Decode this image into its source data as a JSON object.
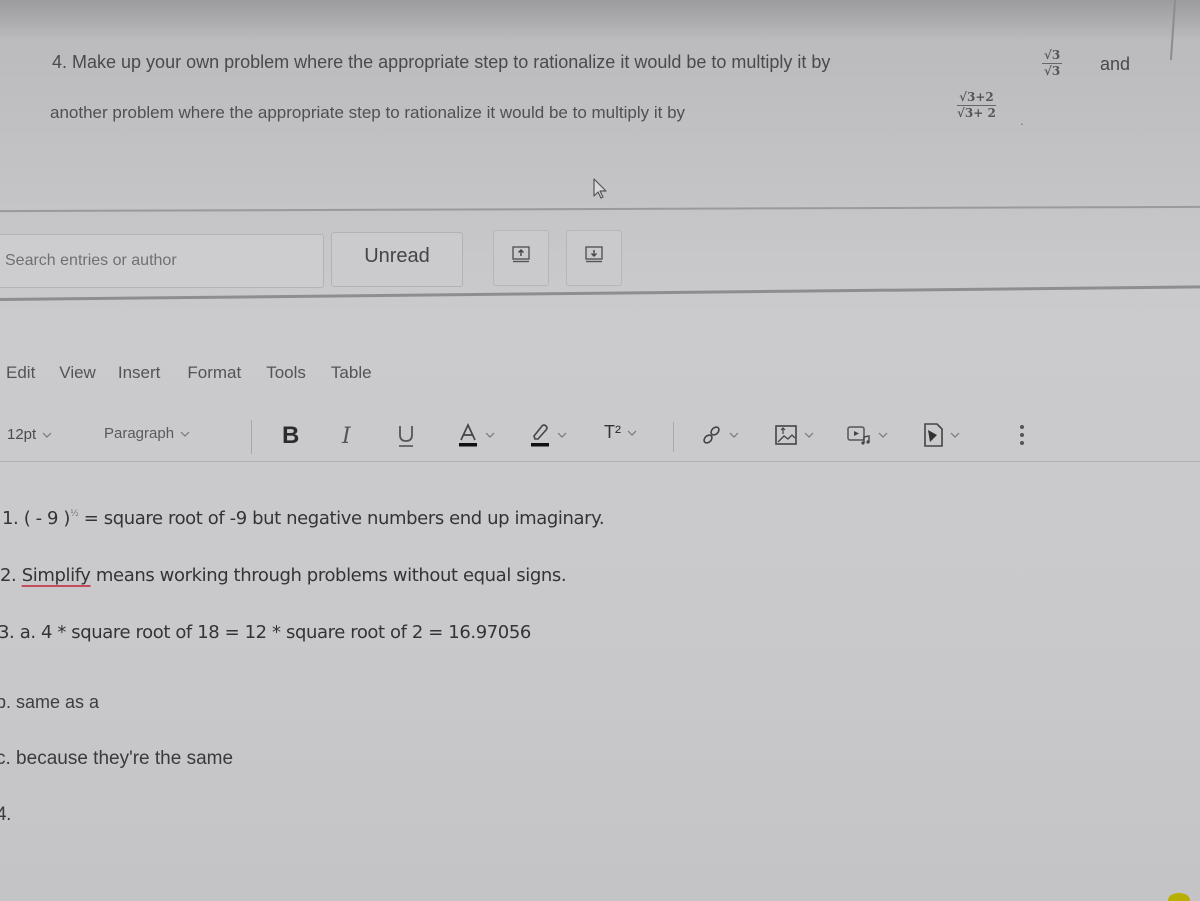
{
  "question": {
    "line1": "4. Make up your own problem where the appropriate step to rationalize it would be to multiply it by",
    "fraction1": {
      "numerator": "√3",
      "denominator": "√3"
    },
    "conjunction": "and",
    "line2": "another problem where the appropriate step to rationalize it would be to multiply it by",
    "fraction2": {
      "numerator": "√3+2",
      "denominator": "√3+ 2"
    },
    "end_punct": "."
  },
  "discussion_toolbar": {
    "search": {
      "value": "",
      "placeholder": "Search entries or author"
    },
    "unread_label": "Unread",
    "buttons": [
      {
        "icon": "expand-up-icon"
      },
      {
        "icon": "collapse-down-icon"
      }
    ]
  },
  "editor": {
    "menu": [
      "Edit",
      "View",
      "Insert",
      "Format",
      "Tools",
      "Table"
    ],
    "toolbar": {
      "font_size": "12pt",
      "block_format": "Paragraph",
      "bold": "B",
      "italic": "I",
      "underline": "U",
      "text_color": "A",
      "superscript": "T²",
      "icons": [
        "link-icon",
        "image-icon",
        "media-icon",
        "document-icon",
        "more-options-icon"
      ],
      "text_color_swatch": "#111111",
      "highlight_swatch": "#111111"
    },
    "content": {
      "line1_prefix": "1. ( - 9 )",
      "line1_exponent": "½",
      "line1_rest": " = square root of -9 but negative numbers end up imaginary.",
      "line2_prefix": "2. ",
      "line2_misspelled": "Simplify",
      "line2_rest": " means working through problems without equal signs.",
      "line3": "3. a. 4 * square root of 18 = 12 * square root of 2 = 16.97056",
      "line4": "b.  same as a",
      "line5": "c. because they're the same",
      "line6": "4."
    },
    "spellcheck_color": "#c44d5c"
  }
}
